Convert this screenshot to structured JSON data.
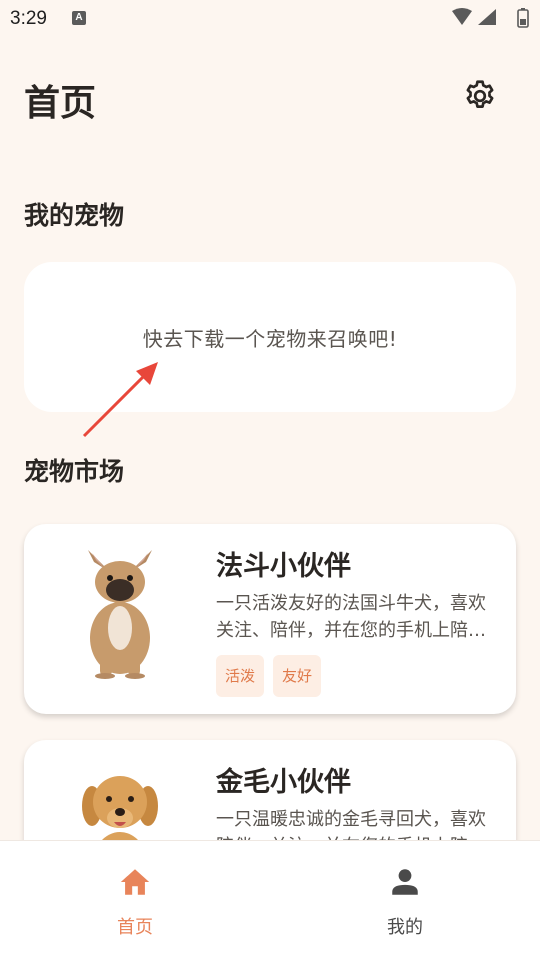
{
  "status_bar": {
    "time": "3:29",
    "notification_badge": "A"
  },
  "header": {
    "title": "首页",
    "settings_icon": "gear-icon"
  },
  "my_pets": {
    "section_title": "我的宠物",
    "empty_message": "快去下载一个宠物来召唤吧!"
  },
  "market": {
    "section_title": "宠物市场",
    "pets": [
      {
        "name": "法斗小伙伴",
        "description": "一只活泼友好的法国斗牛犬，喜欢关注、陪伴，并在您的手机上陪伴您",
        "tags": [
          "活泼",
          "友好"
        ],
        "image": "french-bulldog"
      },
      {
        "name": "金毛小伙伴",
        "description": "一只温暖忠诚的金毛寻回犬，喜欢陪伴、关注，并在您的手机上陪伴您",
        "tags": [],
        "image": "golden-retriever"
      }
    ]
  },
  "bottom_nav": {
    "items": [
      {
        "label": "首页",
        "icon": "home-icon",
        "active": true
      },
      {
        "label": "我的",
        "icon": "person-icon",
        "active": false
      }
    ]
  },
  "colors": {
    "background": "#fdf6f0",
    "accent": "#e8845a",
    "tag_bg": "#fdeee4",
    "tag_text": "#e07a4a",
    "annotation_arrow": "#e8473a"
  }
}
